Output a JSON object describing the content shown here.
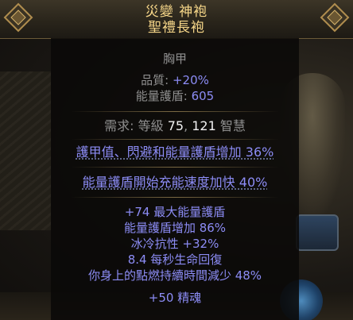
{
  "item": {
    "name": "災變 神袍",
    "base": "聖禮長袍",
    "item_class": "胸甲",
    "quality_label": "品質: ",
    "quality_value": "+20%",
    "es_label": "能量護盾: ",
    "es_value": "605",
    "req_label": "需求: ",
    "req_level_label": "等級",
    "req_level": "75",
    "req_sep": ", ",
    "req_int": "121",
    "req_int_label": "智慧",
    "enchant_mod": "護甲值、閃避和能量護盾增加 36%",
    "implicit_mod": "能量護盾開始充能速度加快 40%",
    "explicit_mods": [
      "+74 最大能量護盾",
      "能量護盾增加 86%",
      "冰冷抗性 +32%",
      "8.4 每秒生命回復",
      "你身上的點燃持續時間減少 48%",
      "+50 精魂"
    ]
  },
  "colors": {
    "title": "#f7d789",
    "label": "#8f8f8f",
    "magic_blue": "#8c8cf5",
    "value_white": "#f1f1f1"
  }
}
